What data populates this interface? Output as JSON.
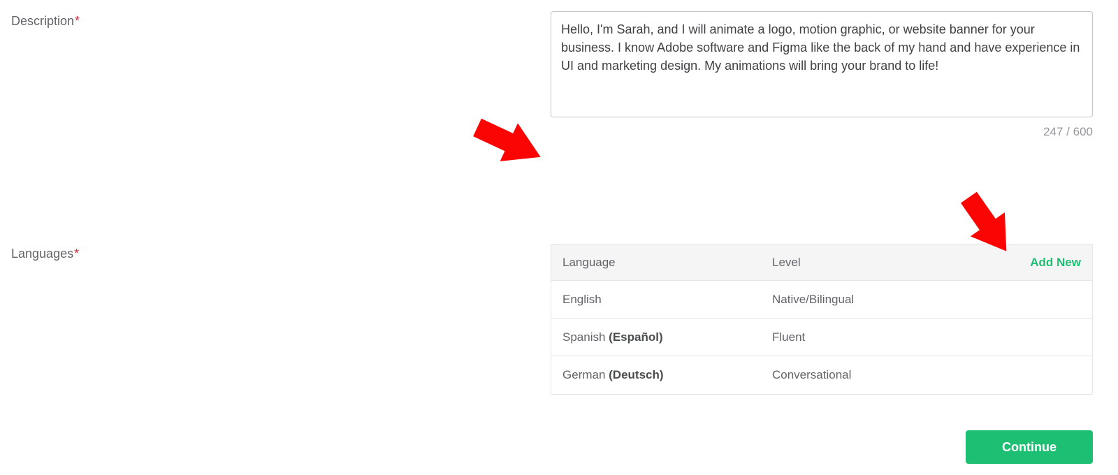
{
  "description": {
    "label": "Description",
    "required_mark": "*",
    "value": "Hello, I'm Sarah, and I will animate a logo, motion graphic, or website banner for your business. I know Adobe software and Figma like the back of my hand and have experience in UI and marketing design. My animations will bring your brand to life!",
    "char_count": "247 / 600"
  },
  "languages": {
    "label": "Languages",
    "required_mark": "*",
    "header": {
      "language": "Language",
      "level": "Level",
      "add_new": "Add New"
    },
    "rows": [
      {
        "name": "English",
        "native": "",
        "level": "Native/Bilingual"
      },
      {
        "name": "Spanish ",
        "native": "(Español)",
        "level": "Fluent"
      },
      {
        "name": "German ",
        "native": "(Deutsch)",
        "level": "Conversational"
      }
    ]
  },
  "buttons": {
    "continue": "Continue"
  }
}
